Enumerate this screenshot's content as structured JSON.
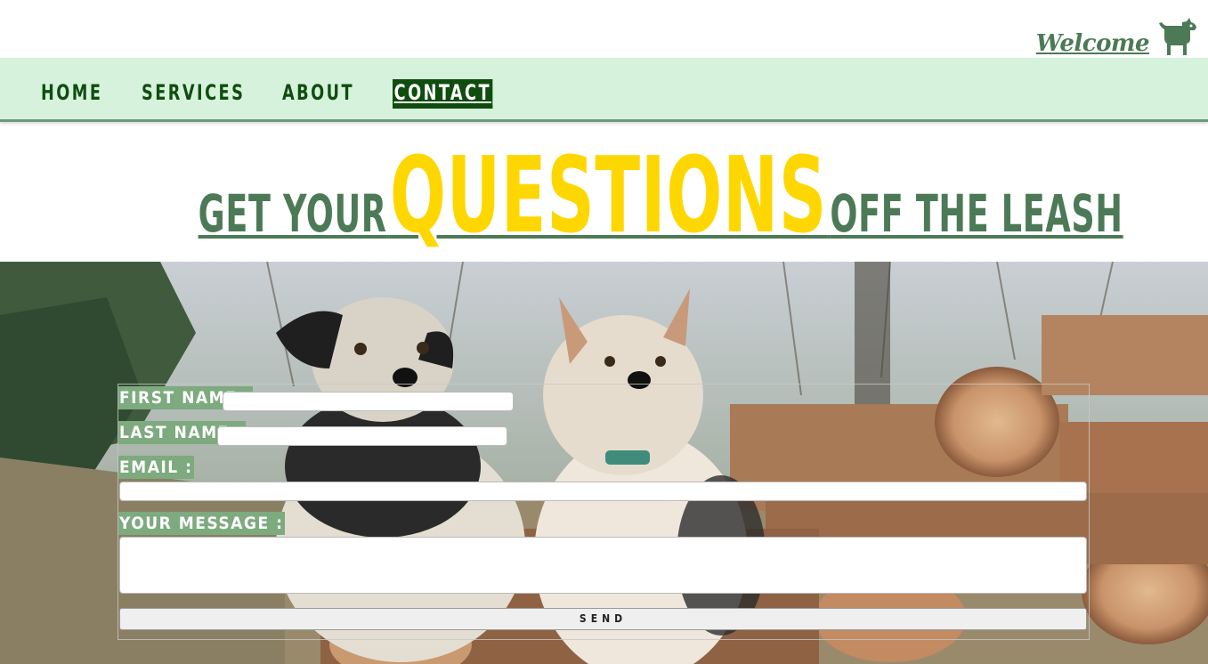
{
  "header": {
    "welcome_label": "Welcome",
    "logo_icon": "dog-icon",
    "brand_color": "#4c7a56"
  },
  "nav": {
    "items": [
      {
        "label": "HOME",
        "active": false
      },
      {
        "label": "SERVICES",
        "active": false
      },
      {
        "label": "ABOUT",
        "active": false
      },
      {
        "label": "CONTACT",
        "active": true
      }
    ],
    "background": "#d6f2dc",
    "text_color": "#0f4d0f"
  },
  "headline": {
    "part1": "GET YOUR",
    "part2": "QUESTIONS",
    "part3": "OFF THE LEASH",
    "accent_color": "#ffd700"
  },
  "form": {
    "first_name_label": "FIRST NAME :",
    "last_name_label": "LAST NAME :",
    "email_label": "EMAIL :",
    "message_label": "YOUR MESSAGE :",
    "first_name_value": "",
    "last_name_value": "",
    "email_value": "",
    "message_value": "",
    "send_label": "SEND",
    "label_color": "#7daa7e"
  }
}
